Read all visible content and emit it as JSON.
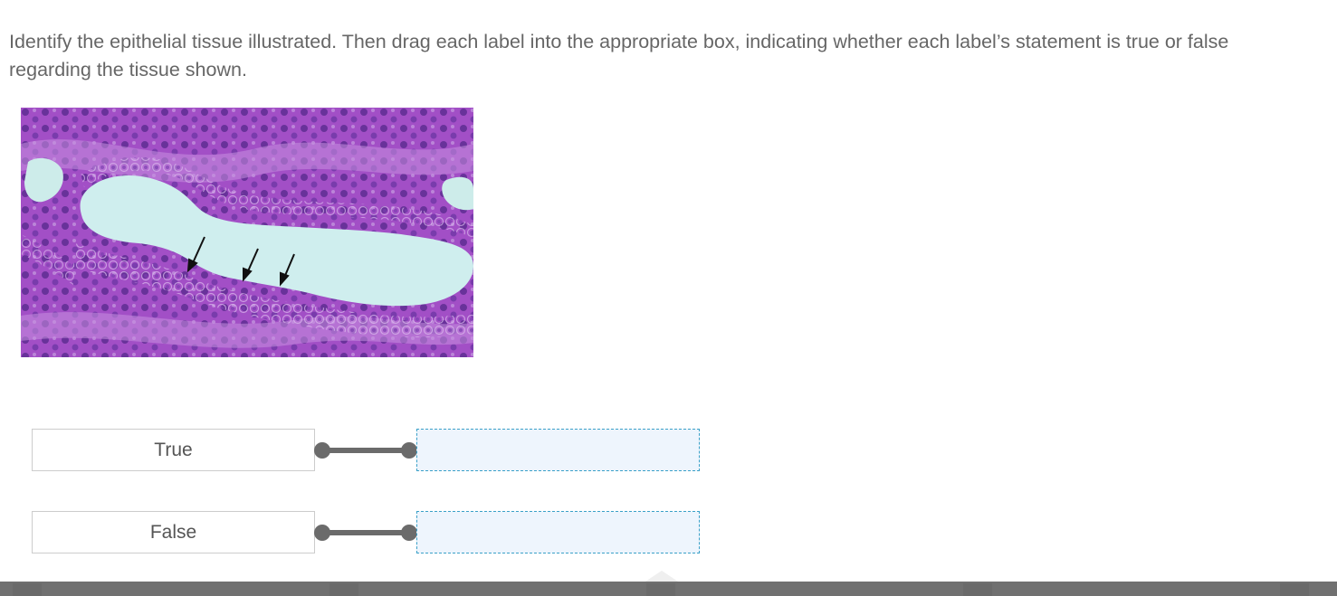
{
  "question": {
    "instructions": "Identify the epithelial tissue illustrated.  Then drag each label into the appropriate box, indicating whether each label’s statement is true or false regarding the tissue shown."
  },
  "image": {
    "subject": "micrograph-epithelial-tissue"
  },
  "rows": [
    {
      "label": "True"
    },
    {
      "label": "False"
    }
  ],
  "colors": {
    "text": "#666666",
    "connector": "#6b6b6b",
    "drop_border": "#3aa0c8",
    "drop_fill": "#eef5fd",
    "stain": "#9b48c2",
    "lumen": "#c8ecec"
  }
}
